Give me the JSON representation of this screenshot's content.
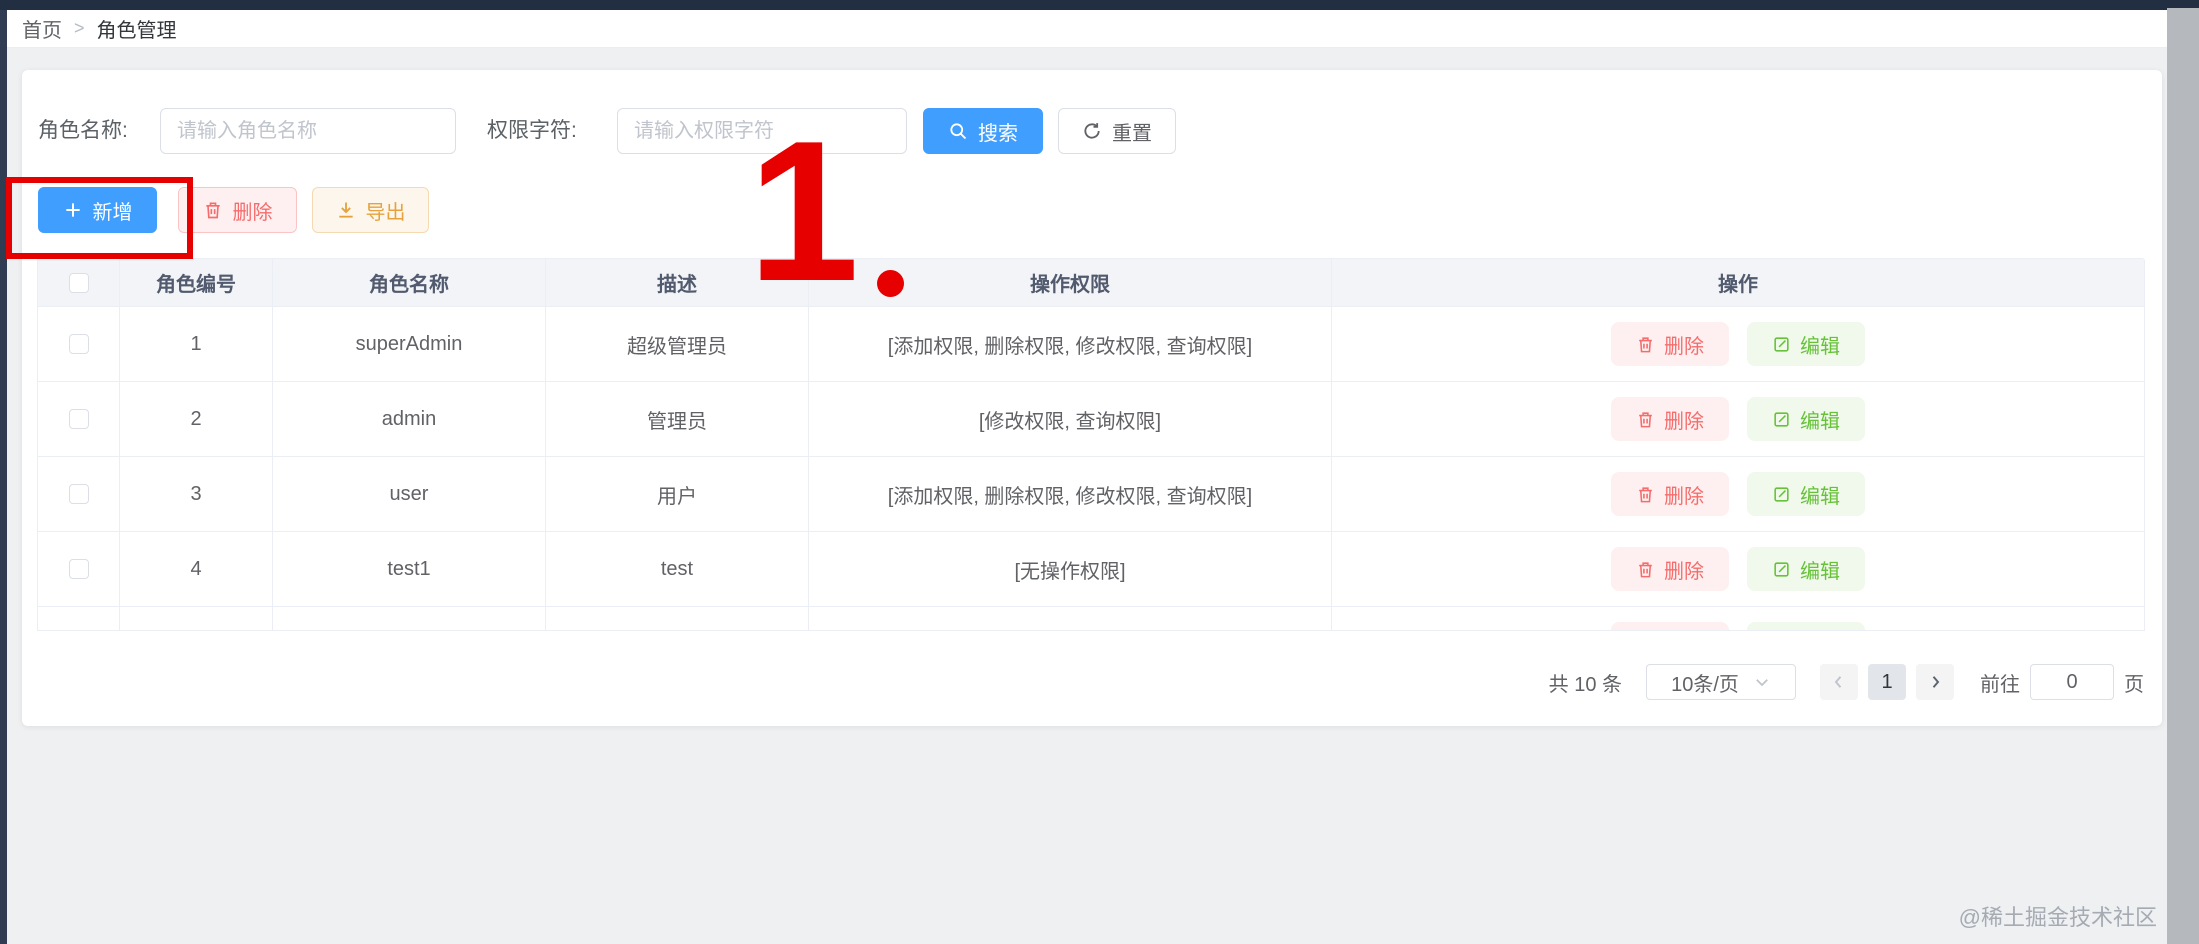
{
  "breadcrumb": {
    "home": "首页",
    "separator": ">",
    "current": "角色管理"
  },
  "search": {
    "fields": [
      {
        "label": "角色名称:",
        "placeholder": "请输入角色名称"
      },
      {
        "label": "权限字符:",
        "placeholder": "请输入权限字符"
      }
    ],
    "search_label": "搜索",
    "reset_label": "重置"
  },
  "toolbar": {
    "add_label": "新增",
    "delete_label": "删除",
    "export_label": "导出"
  },
  "table": {
    "columns": [
      "角色编号",
      "角色名称",
      "描述",
      "操作权限",
      "操作"
    ],
    "rows": [
      {
        "id": "1",
        "name": "superAdmin",
        "desc": "超级管理员",
        "perms": "[添加权限, 删除权限, 修改权限, 查询权限]"
      },
      {
        "id": "2",
        "name": "admin",
        "desc": "管理员",
        "perms": "[修改权限, 查询权限]"
      },
      {
        "id": "3",
        "name": "user",
        "desc": "用户",
        "perms": "[添加权限, 删除权限, 修改权限, 查询权限]"
      },
      {
        "id": "4",
        "name": "test1",
        "desc": "test",
        "perms": "[无操作权限]"
      }
    ],
    "row_actions": {
      "delete": "删除",
      "edit": "编辑"
    }
  },
  "pagination": {
    "total_text": "共 10 条",
    "page_size": "10条/页",
    "current_page": "1",
    "jump_prefix": "前往",
    "jump_value": "0",
    "jump_suffix": "页"
  },
  "annotation": {
    "step_number": "1"
  },
  "watermark": "@稀土掘金技术社区",
  "colors": {
    "primary": "#409eff",
    "danger": "#f56c6c",
    "warning": "#e6a23c",
    "success": "#67c23a",
    "annotation": "#e60000",
    "topbar": "#222e42"
  }
}
